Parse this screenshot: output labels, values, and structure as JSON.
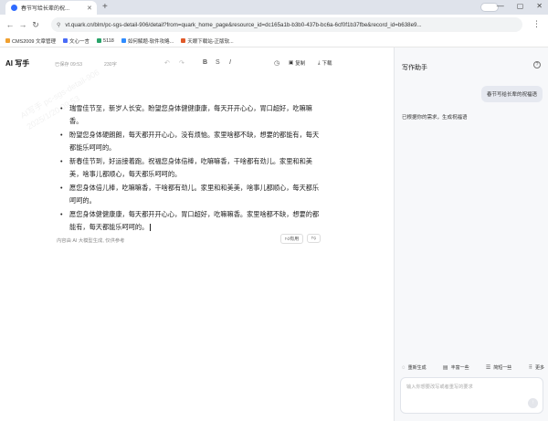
{
  "browser": {
    "tab_title": "春节写给长辈的祝...",
    "new_tab": "+",
    "window_controls": [
      "—",
      "▢",
      "✕"
    ],
    "url": "vt.quark.cn/blm/pc-sgs-detail-906/detail?from=quark_home_page&resource_id=dc165a1b-b3b0-437b-bc6a-6cf0f1b37fbe&record_id=b638e9..."
  },
  "bookmarks": [
    {
      "label": "CMS2009 文章管理",
      "color": "#f0a030"
    },
    {
      "label": "文心一言",
      "color": "#4a6cf7"
    },
    {
      "label": "5118",
      "color": "#2aa46a"
    },
    {
      "label": "如何解题-软件攻略...",
      "color": "#2f8cff"
    },
    {
      "label": "天眼下载站-正版软...",
      "color": "#e05a2a"
    }
  ],
  "editor": {
    "brand": "AI 写手",
    "saved": "已保存 09:53",
    "word_count": "230字",
    "copy_label": "复制",
    "download_label": "下载"
  },
  "document": {
    "items": [
      "瑞雪佳节至，新岁人长安。盼望您身体健健康康，每天开开心心，胃口超好，吃嘛嘛香。",
      "盼望您身体硬朗朗，每天都开开心心，没有烦恼。家里啥都不缺，想要的都能有，每天都能乐呵呵的。",
      "新春佳节到，好运接着跑。祝福您身体倍棒，吃嘛嘛香，干啥都有劲儿。家里和和美美，啥事儿都顺心，每天都乐呵呵的。",
      "愿您身体倍儿棒，吃嘛嘛香，干啥都有劲儿。家里和和美美，啥事儿都顺心，每天都乐呵呵的。",
      "愿您身体健健康康，每天都开开心心，胃口超好，吃嘛嘛香。家里啥都不缺，想要的都能有，每天都能乐呵呵的。"
    ],
    "footer_note": "内容由 AI 大模型生成, 仅供参考",
    "like_label": "有用",
    "dislike_label": "",
    "watermark": "AI写手 pc-sgs-detail-906\n2025/1/20 09:53"
  },
  "panel": {
    "title": "写作助手",
    "user_message": "春节写给长辈的祝福语",
    "reply": "已根据你的需求，生成祝福语",
    "actions": [
      {
        "icon": "refresh-icon",
        "glyph": "◌",
        "label": "重新生成"
      },
      {
        "icon": "simplify-icon",
        "glyph": "▤",
        "label": "丰富一些"
      },
      {
        "icon": "shorten-icon",
        "glyph": "☰",
        "label": "简短一些"
      },
      {
        "icon": "more-icon",
        "glyph": "⁞⁞",
        "label": "更多"
      }
    ],
    "input_placeholder": "输入你想要改写或者重写的要求",
    "send_label": "↑"
  }
}
